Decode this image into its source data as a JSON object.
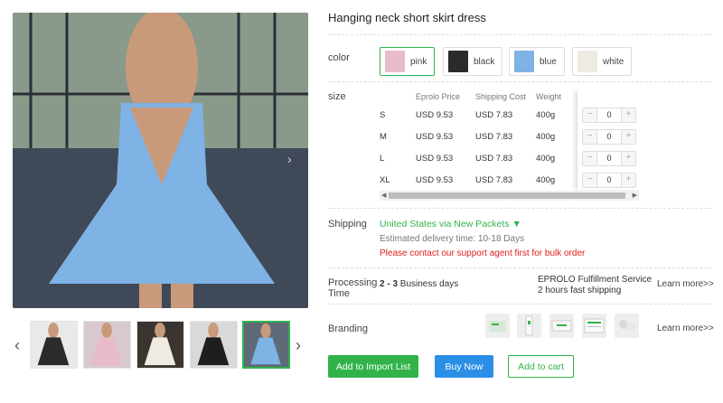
{
  "product": {
    "title": "Hanging neck short skirt dress"
  },
  "gallery": {
    "main_color": "#7fb2e5",
    "thumbnails": [
      {
        "name": "black",
        "color": "#2b2b2b"
      },
      {
        "name": "pink",
        "color": "#e8bcc8"
      },
      {
        "name": "white",
        "color": "#efeae2"
      },
      {
        "name": "black",
        "color": "#1e1e1e"
      },
      {
        "name": "blue",
        "color": "#7fb2e5"
      }
    ],
    "prev_icon": "chevron-left-icon",
    "next_icon": "chevron-right-icon"
  },
  "color": {
    "label": "color",
    "options": [
      {
        "label": "pink",
        "swatch": "#e8bcc8"
      },
      {
        "label": "black",
        "swatch": "#2b2b2b"
      },
      {
        "label": "blue",
        "swatch": "#7fb2e5"
      },
      {
        "label": "white",
        "swatch": "#efeae2"
      }
    ],
    "selected": "pink"
  },
  "size": {
    "label": "size",
    "headers": {
      "price": "Eprolo Price",
      "shipping": "Shipping Cost",
      "weight": "Weight"
    },
    "rows": [
      {
        "size": "S",
        "price": "USD 9.53",
        "shipping": "USD 7.83",
        "weight": "400g",
        "qty": "0"
      },
      {
        "size": "M",
        "price": "USD 9.53",
        "shipping": "USD 7.83",
        "weight": "400g",
        "qty": "0"
      },
      {
        "size": "L",
        "price": "USD 9.53",
        "shipping": "USD 7.83",
        "weight": "400g",
        "qty": "0"
      },
      {
        "size": "XL",
        "price": "USD 9.53",
        "shipping": "USD 7.83",
        "weight": "400g",
        "qty": "0"
      }
    ],
    "minus": "−",
    "plus": "+",
    "scroll_left": "◀",
    "scroll_right": "▶"
  },
  "shipping": {
    "label": "Shipping",
    "method": "United States via New Packets ▼",
    "estimate": "Estimated delivery time: 10-18 Days",
    "warning": "Please contact our support agent first for bulk order"
  },
  "processing": {
    "label_line1": "Processing",
    "label_line2": "Time",
    "days_bold": "2 - 3",
    "days_rest": " Business days",
    "service_line1": "EPROLO Fulfillment Service",
    "service_line2": "2 hours fast shipping",
    "learn_more": "Learn more>>"
  },
  "branding": {
    "label": "Branding",
    "icons": [
      "packaging-bag-icon",
      "card-tag-icon",
      "label-sticker-icon",
      "invoice-card-icon",
      "thank-you-card-icon"
    ],
    "learn_more": "Learn more>>"
  },
  "actions": {
    "import": "Add to Import List",
    "buy": "Buy Now",
    "cart": "Add to cart"
  },
  "colors": {
    "accent_green": "#31b34a",
    "buy_blue": "#2c8fe6",
    "warning_red": "#e02020"
  }
}
